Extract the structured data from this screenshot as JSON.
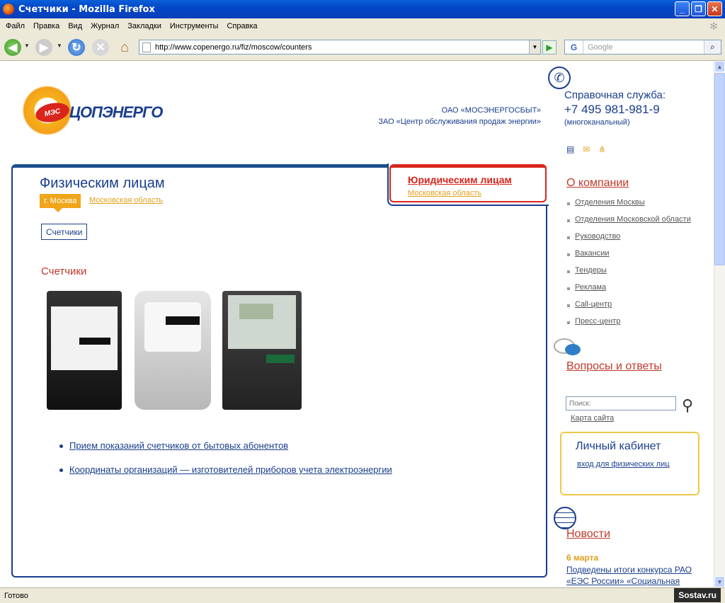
{
  "window": {
    "title": "Счетчики - Mozilla Firefox"
  },
  "menu": [
    "Файл",
    "Правка",
    "Вид",
    "Журнал",
    "Закладки",
    "Инструменты",
    "Справка"
  ],
  "address": {
    "url": "http://www.copenergo.ru/fiz/moscow/counters"
  },
  "websearch": {
    "placeholder": "Google"
  },
  "status": {
    "text": "Готово",
    "badge": "Sostav.ru"
  },
  "header": {
    "brand": "ЦОПЭНЕРГО",
    "brand_badge": "МЭС",
    "org1": "ОАО «МОСЭНЕРГОСБЫТ»",
    "org2": "ЗАО «Центр обслуживания продаж энергии»",
    "help_title": "Справочная служба:",
    "help_phone": "+7 495 981-981-9",
    "help_note": "(многоканальный)"
  },
  "tabs": {
    "physical": "Физическим лицам",
    "region_active": "г. Москва",
    "region_other": "Московская область",
    "legal": "Юридическим лицам",
    "legal_region": "Московская область"
  },
  "content": {
    "subtab": "Счетчики",
    "title": "Счетчики",
    "links": [
      "Прием показаний счетчиков от бытовых абонентов",
      "Координаты организаций — изготовителей приборов учета электроэнергии"
    ]
  },
  "sidebar": {
    "company_title": "О компании",
    "company_items": [
      "Отделения Москвы",
      "Отделения Московской области",
      "Руководство",
      "Вакансии",
      "Тендеры",
      "Реклама",
      "Call-центр",
      "Пресс-центр"
    ],
    "qa_title": "Вопросы и ответы",
    "search_placeholder": "Поиск:",
    "sitemap": "Карта сайта",
    "cabinet_title": "Личный кабинет",
    "cabinet_link": "вход для физических лиц",
    "news_title": "Новости",
    "news_date": "6 марта",
    "news_text": "Подведены итоги конкурса РАО «ЕЭС России» «Социальная"
  },
  "icons": {
    "back": "back-arrow-icon",
    "forward": "forward-arrow-icon",
    "reload": "reload-icon",
    "stop": "stop-icon",
    "home": "home-icon"
  },
  "colors": {
    "brand_blue": "#1a3e8c",
    "accent_red": "#d9251c",
    "accent_orange": "#f0a61a"
  }
}
